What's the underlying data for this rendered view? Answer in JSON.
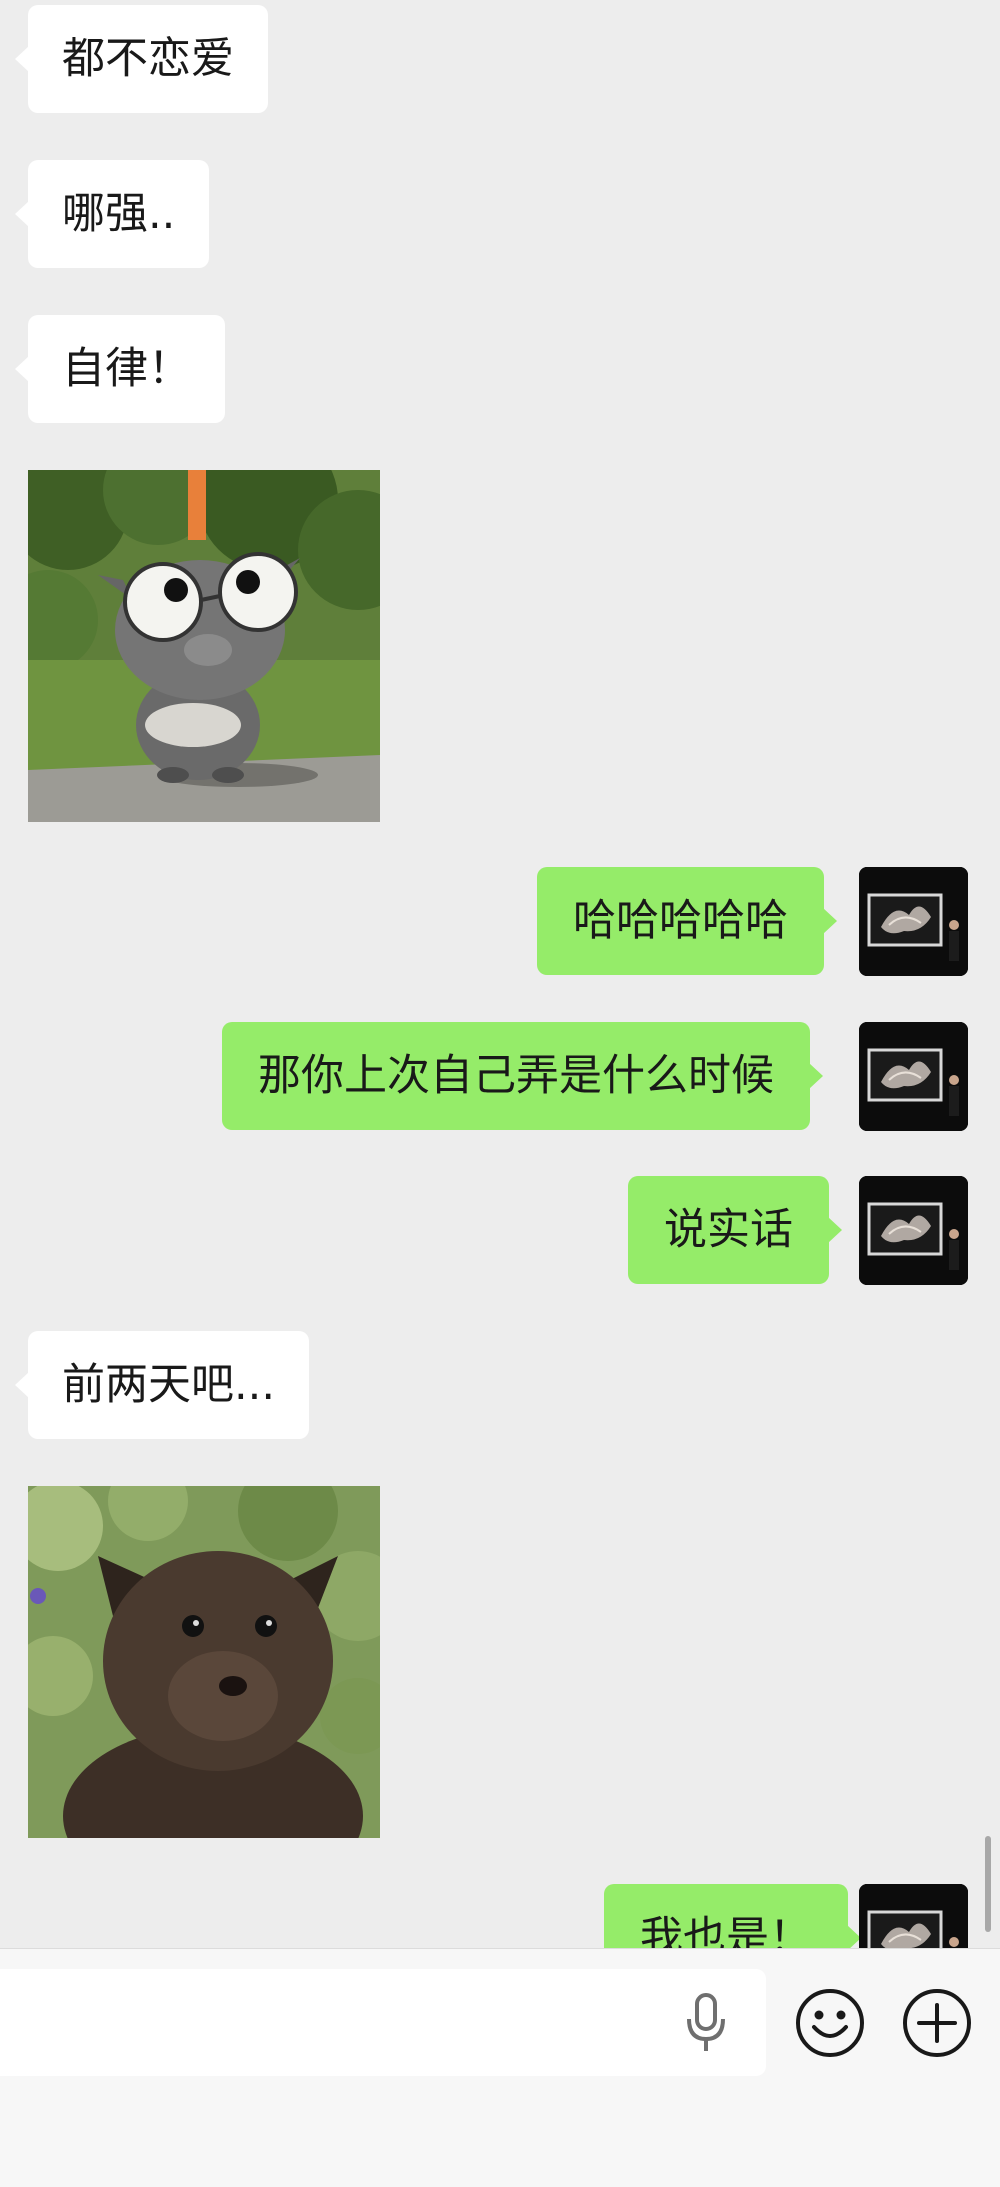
{
  "app": {
    "accent_color": "#95ec69",
    "background_color": "#ededed"
  },
  "messages": [
    {
      "side": "in",
      "type": "text",
      "text": "都不恋爱"
    },
    {
      "side": "in",
      "type": "text",
      "text": "哪强.."
    },
    {
      "side": "in",
      "type": "text",
      "text": "自律！"
    },
    {
      "side": "in",
      "type": "sticker",
      "icon": "cartoon-glasses-creature-sticker"
    },
    {
      "side": "out",
      "type": "text",
      "text": "哈哈哈哈哈"
    },
    {
      "side": "out",
      "type": "text",
      "text": "那你上次自己弄是什么时候"
    },
    {
      "side": "out",
      "type": "text",
      "text": "说实话"
    },
    {
      "side": "in",
      "type": "text",
      "text": "前两天吧..."
    },
    {
      "side": "in",
      "type": "sticker",
      "icon": "puppy-sticker"
    },
    {
      "side": "out",
      "type": "text",
      "text": "我也是！"
    }
  ],
  "input_bar": {
    "text": "",
    "icons": [
      "voice-mic-icon",
      "emoji-icon",
      "plus-icon"
    ]
  }
}
